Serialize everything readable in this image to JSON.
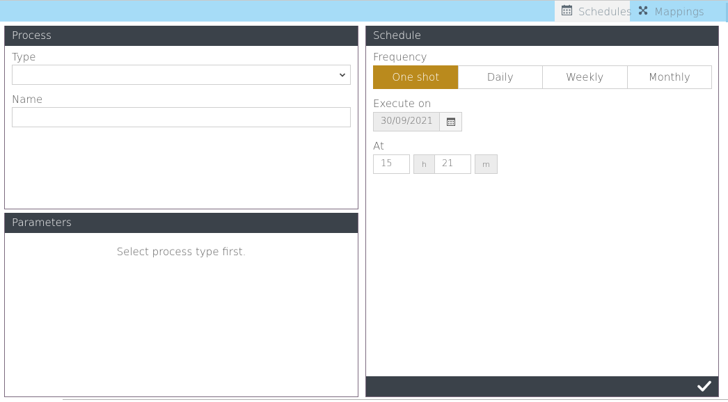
{
  "tabs": [
    {
      "label": "Schedules",
      "icon": "calendar-icon",
      "active": true
    },
    {
      "label": "Mappings",
      "icon": "mappings-icon",
      "active": false
    }
  ],
  "process": {
    "title": "Process",
    "type_label": "Type",
    "type_value": "",
    "name_label": "Name",
    "name_value": ""
  },
  "parameters": {
    "title": "Parameters",
    "empty_message": "Select process type first."
  },
  "schedule": {
    "title": "Schedule",
    "frequency_label": "Frequency",
    "frequency_options": [
      "One shot",
      "Daily",
      "Weekly",
      "Monthly"
    ],
    "frequency_selected": "One shot",
    "execute_on_label": "Execute on",
    "execute_on_value": "30/09/2021",
    "at_label": "At",
    "hour": "15",
    "hour_unit": "h",
    "minute": "21",
    "minute_unit": "m"
  },
  "colors": {
    "topbar": "#a6dcf7",
    "panel_header": "#3b424a",
    "accent": "#ba8a1d"
  }
}
